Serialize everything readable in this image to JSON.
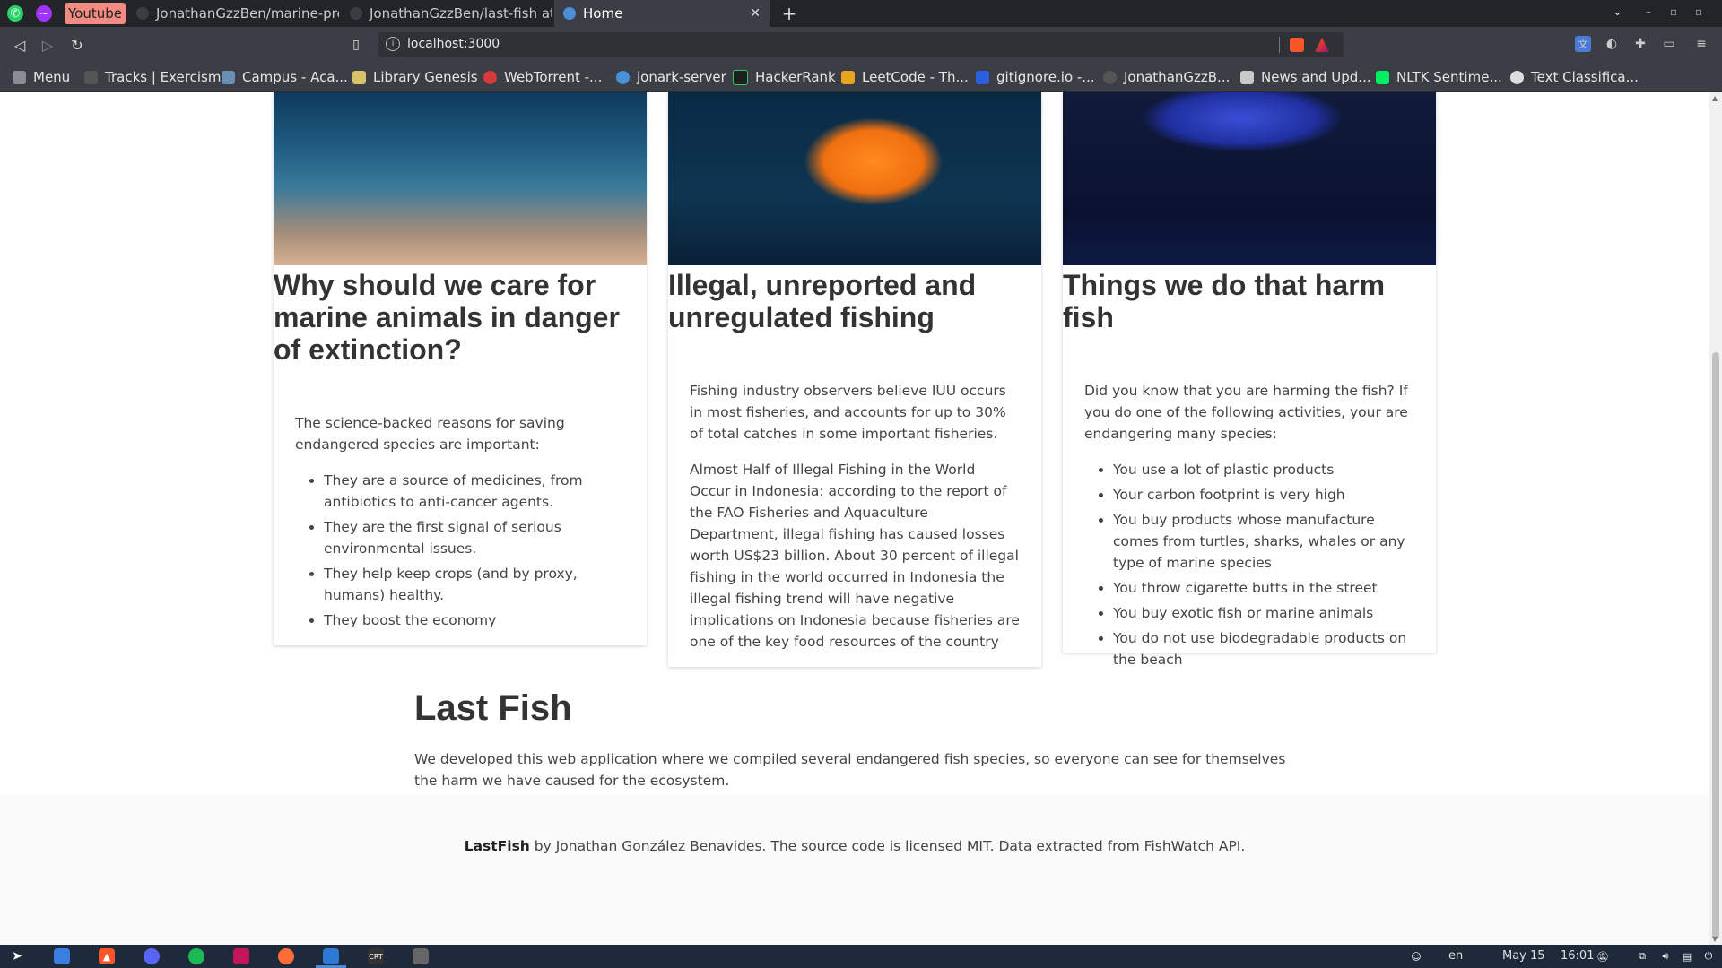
{
  "browser": {
    "tabs": [
      {
        "label": "Youtube"
      },
      {
        "label": "JonathanGzzBen/marine-pres"
      },
      {
        "label": "JonathanGzzBen/last-fish at d"
      },
      {
        "label": "Home"
      }
    ],
    "url": "localhost:3000",
    "bookmarks": [
      "Menu",
      "Tracks | Exercism",
      "Campus - Aca...",
      "Library Genesis",
      "WebTorrent -...",
      "jonark-server",
      "HackerRank",
      "LeetCode - Th...",
      "gitignore.io -...",
      "JonathanGzzB...",
      "News and Upd...",
      "NLTK Sentime...",
      "Text Classifica..."
    ]
  },
  "cards": [
    {
      "title": "Why should we care for marine animals in danger of extinction?",
      "intro": "The science-backed reasons for saving endangered species are important:",
      "items": [
        "They are a source of medicines, from antibiotics to anti-cancer agents.",
        "They are the first signal of serious environmental issues.",
        "They help keep crops (and by proxy, humans) healthy.",
        "They boost the economy"
      ]
    },
    {
      "title": "Illegal, unreported and unregulated fishing",
      "paragraph1": "Fishing industry observers believe IUU occurs in most fisheries, and accounts for up to 30% of total catches in some important fisheries.",
      "paragraph2": "Almost Half of Illegal Fishing in the World Occur in Indonesia: according to the report of the FAO Fisheries and Aquaculture Department, illegal fishing has caused losses worth US$23 billion. About 30 percent of illegal fishing in the world occurred in Indonesia the illegal fishing trend will have negative implications on Indonesia because fisheries are one of the key food resources of the country"
    },
    {
      "title": "Things we do that harm fish",
      "intro": "Did you know that you are harming the fish? If you do one of the following activities, your are endangering many species:",
      "items": [
        "You use a lot of plastic products",
        "Your carbon footprint is very high",
        "You buy products whose manufacture comes from turtles, sharks, whales or any type of marine species",
        "You throw cigarette butts in the street",
        "You buy exotic fish or marine animals",
        "You do not use biodegradable products on the beach"
      ]
    }
  ],
  "about": {
    "heading": "Last Fish",
    "text": "We developed this web application where we compiled several endangered fish species, so everyone can see for themselves the harm we have caused for the ecosystem."
  },
  "footer": {
    "brand": "LastFish",
    "text": " by Jonathan González Benavides. The source code is licensed MIT. Data extracted from FishWatch API."
  },
  "taskbar": {
    "lang": "en",
    "date": "May 15",
    "time": "16:01"
  },
  "colors": {
    "chrome_dark": "#222428",
    "chrome": "#3b3e44",
    "youtube_tab": "#f28b82",
    "taskbar": "#1e2a3a",
    "footer_bg": "#fafafa"
  }
}
